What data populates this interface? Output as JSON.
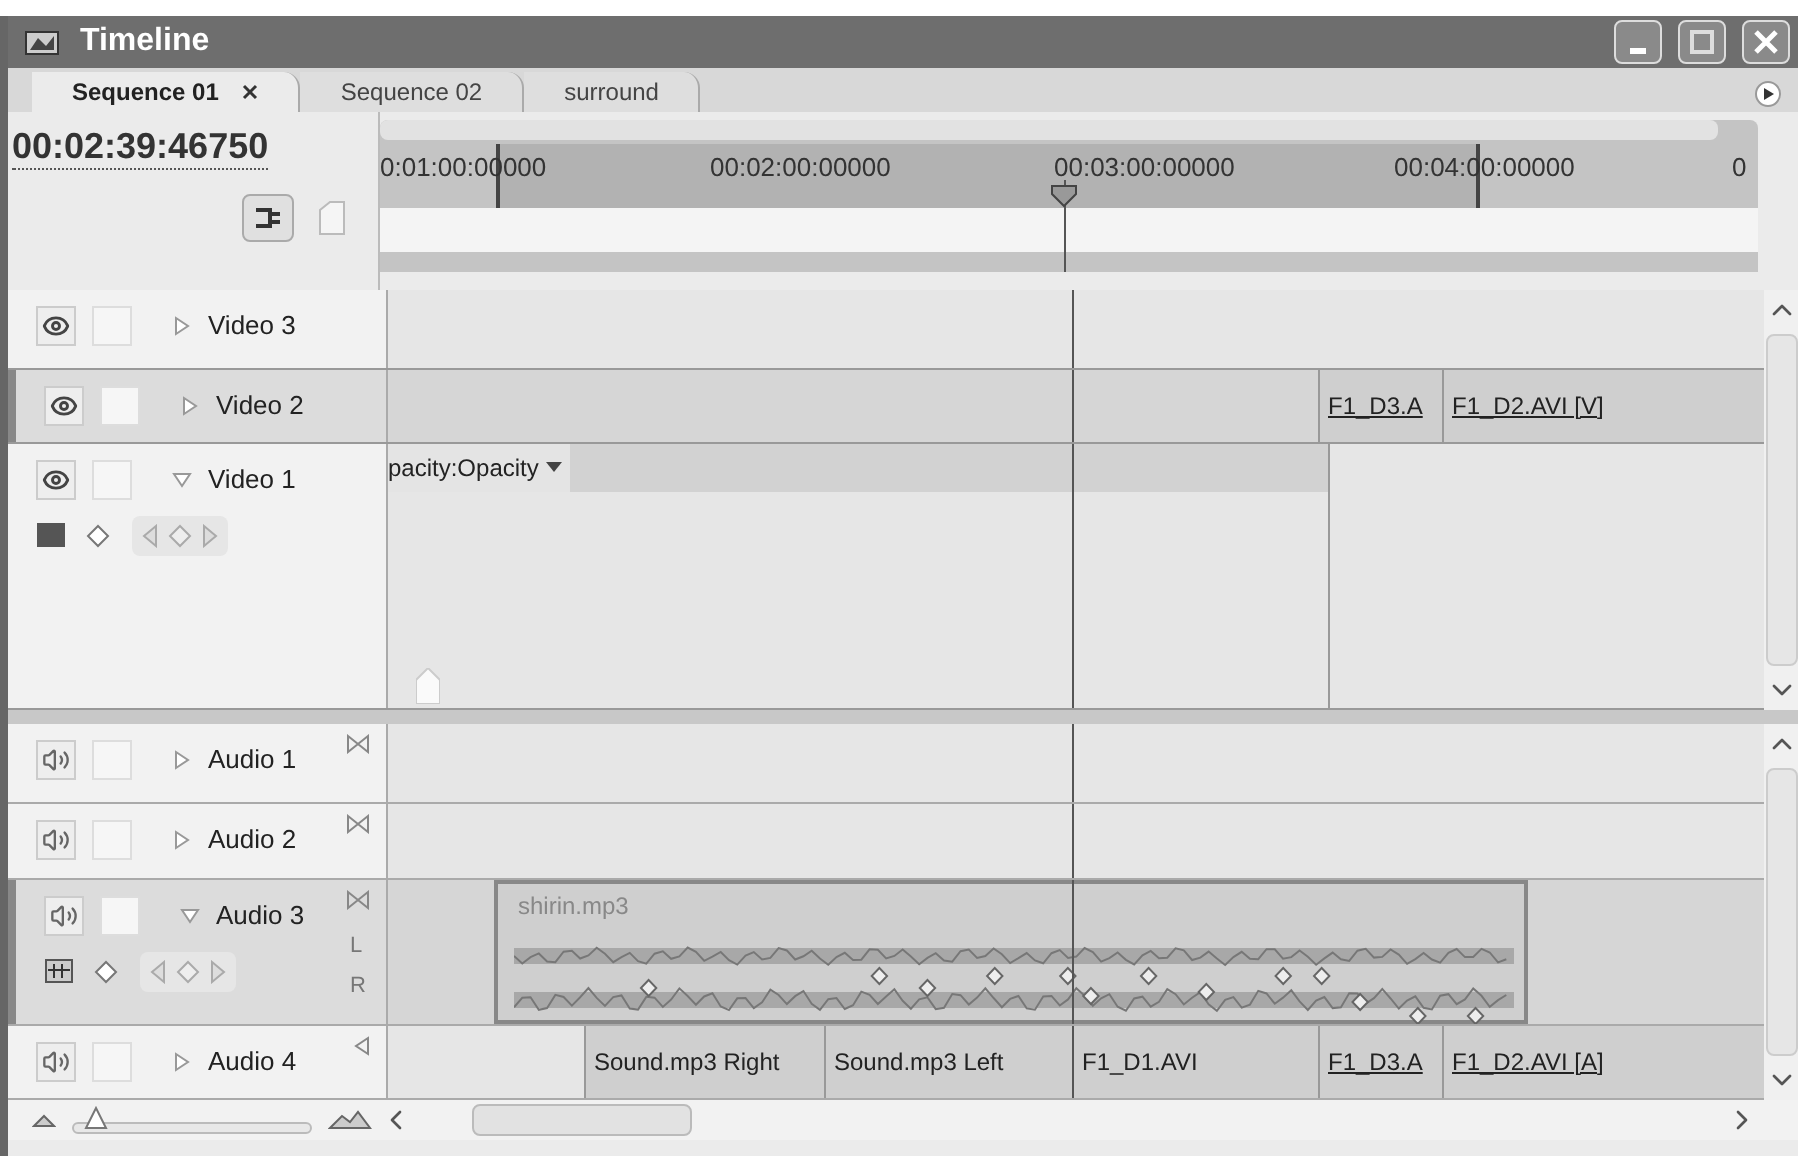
{
  "window": {
    "title": "Timeline"
  },
  "tabs": [
    {
      "label": "Sequence 01",
      "selected": true,
      "closable": true
    },
    {
      "label": "Sequence 02",
      "selected": false,
      "closable": false
    },
    {
      "label": "surround",
      "selected": false,
      "closable": false
    }
  ],
  "timecode": "00:02:39:46750",
  "ruler": {
    "labels": [
      "0:01:00:00000",
      "00:02:00:00000",
      "00:03:00:00000",
      "00:04:00:00000",
      "0"
    ]
  },
  "video_tracks": [
    {
      "name": "Video 3",
      "expanded": false,
      "selected": false
    },
    {
      "name": "Video 2",
      "expanded": false,
      "selected": true,
      "clips": [
        {
          "label": "F1_D3.A",
          "linked": true
        },
        {
          "label": "F1_D2.AVI [V]",
          "linked": true
        }
      ]
    },
    {
      "name": "Video 1",
      "expanded": true,
      "selected": false,
      "effect_label": "pacity:Opacity"
    }
  ],
  "audio_tracks": [
    {
      "name": "Audio 1",
      "expanded": false,
      "selected": false,
      "kind": "stereo"
    },
    {
      "name": "Audio 2",
      "expanded": false,
      "selected": false,
      "kind": "stereo"
    },
    {
      "name": "Audio 3",
      "expanded": true,
      "selected": true,
      "kind": "stereo",
      "channel_labels": [
        "L",
        "R"
      ],
      "clips": [
        {
          "label": "shirin.mp3",
          "linked": false
        }
      ]
    },
    {
      "name": "Audio 4",
      "expanded": false,
      "selected": false,
      "kind": "mono",
      "clips": [
        {
          "label": "Sound.mp3 Right",
          "linked": false
        },
        {
          "label": "Sound.mp3 Left",
          "linked": false
        },
        {
          "label": "F1_D1.AVI",
          "linked": false
        },
        {
          "label": "F1_D3.A",
          "linked": true
        },
        {
          "label": "F1_D2.AVI [A]",
          "linked": true
        }
      ]
    }
  ],
  "zoom_slider": {
    "level": 0.05
  }
}
